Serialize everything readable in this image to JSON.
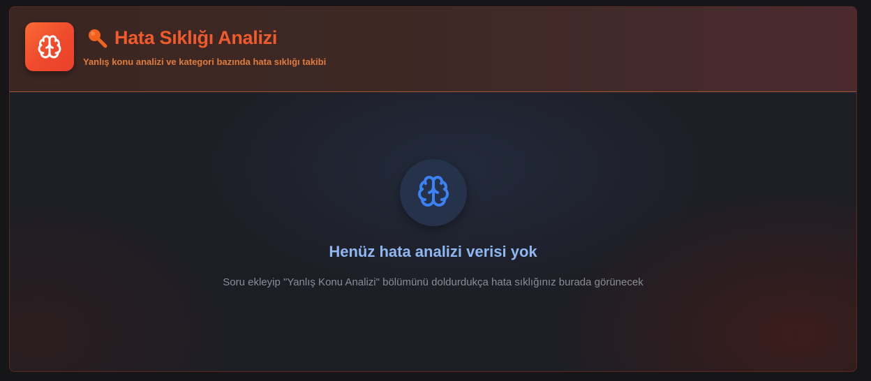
{
  "header": {
    "title": "Hata Sıklığı Analizi",
    "subtitle": "Yanlış konu analizi ve kategori bazında hata sıklığı takibi",
    "app_icon": "brain-icon",
    "title_icon": "magnifier-icon"
  },
  "empty_state": {
    "icon": "brain-icon",
    "title": "Henüz hata analizi verisi yok",
    "description": "Soru ekleyip \"Yanlış Konu Analizi\" bölümünü doldurdukça hata sıklığınız burada görünecek"
  },
  "colors": {
    "accent_orange": "#f05a2d",
    "subtitle_orange": "#e07c3d",
    "empty_title_blue": "#8fb8f2",
    "brain_blue": "#3b82f6"
  }
}
